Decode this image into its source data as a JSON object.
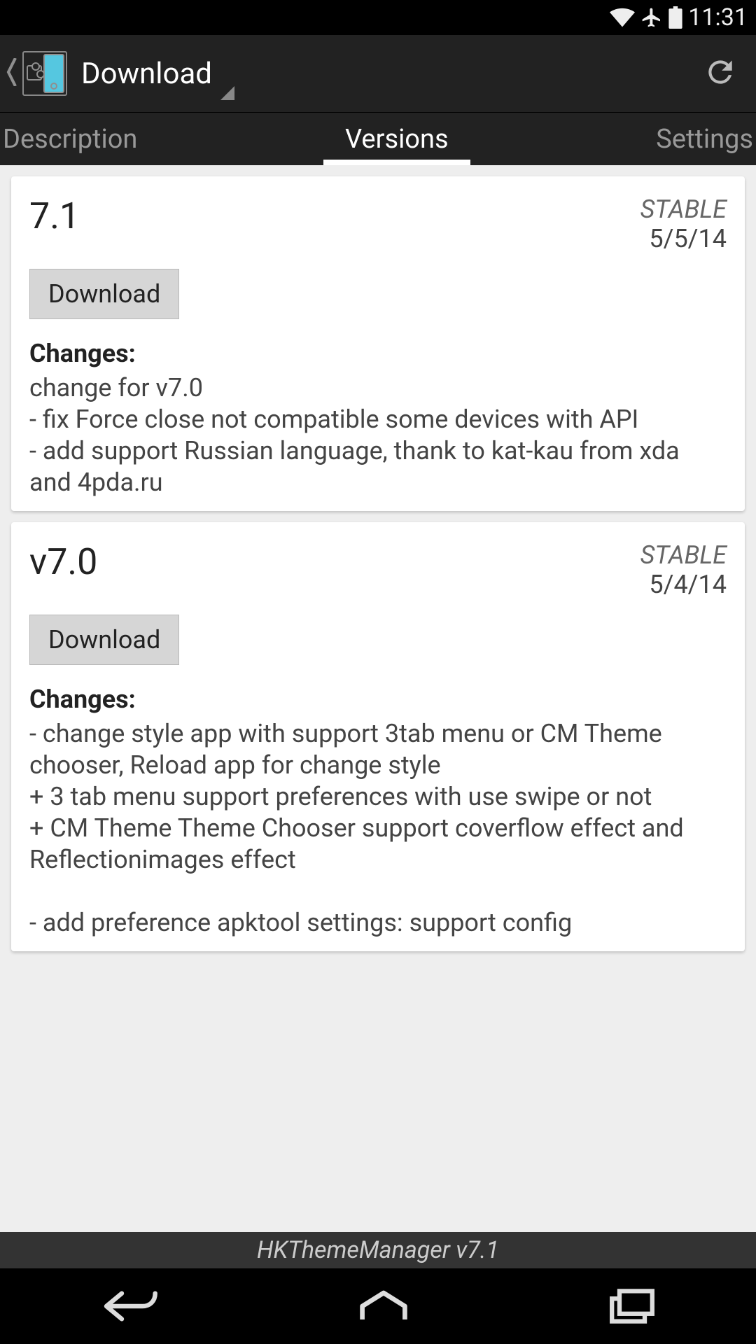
{
  "status_bar": {
    "time": "11:31"
  },
  "action_bar": {
    "title": "Download"
  },
  "tabs": {
    "description": "Description",
    "versions": "Versions",
    "settings": "Settings",
    "active": "versions"
  },
  "versions": [
    {
      "name": "7.1",
      "stability": "STABLE",
      "date": "5/5/14",
      "download_label": "Download",
      "changes_label": "Changes:",
      "changes_body": "change for v7.0\n- fix Force close not compatible some devices with API\n- add support Russian language, thank to kat-kau from xda and 4pda.ru"
    },
    {
      "name": "v7.0",
      "stability": "STABLE",
      "date": "5/4/14",
      "download_label": "Download",
      "changes_label": "Changes:",
      "changes_body": "- change style app with support 3tab menu or CM Theme chooser, Reload app for change style\n+ 3 tab menu support preferences with use swipe or not\n+ CM Theme Theme Chooser support coverflow effect and Reflectionimages effect\n\n- add preference apktool settings: support config"
    }
  ],
  "footer": {
    "app_label": "HKThemeManager v7.1"
  }
}
